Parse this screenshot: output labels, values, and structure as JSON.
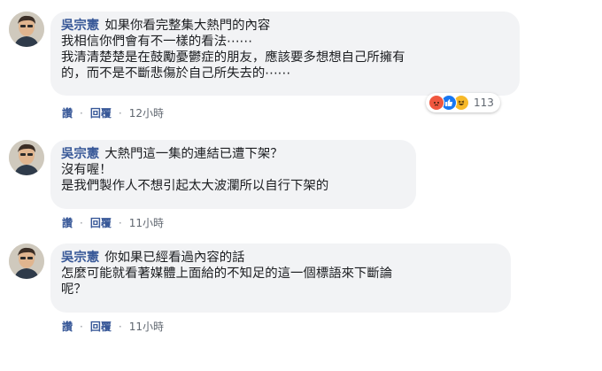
{
  "comments": [
    {
      "author": "吳宗憲",
      "lines": [
        "如果你看完整集大熱門的內容",
        "我相信你們會有不一樣的看法⋯⋯",
        "我清清楚楚是在鼓勵憂鬱症的朋友，應該要多想想自己所擁有",
        "的，而不是不斷悲傷於自己所失去的⋯⋯"
      ],
      "like_label": "讚",
      "reply_label": "回覆",
      "timestamp": "12小時",
      "reaction_count": "113"
    },
    {
      "author": "吳宗憲",
      "lines": [
        "大熱門這一集的連結已遭下架？",
        "沒有喔！",
        "是我們製作人不想引起太大波瀾所以自行下架的"
      ],
      "like_label": "讚",
      "reply_label": "回覆",
      "timestamp": "11小時"
    },
    {
      "author": "吳宗憲",
      "lines": [
        "你如果已經看過內容的話",
        "怎麼可能就看著媒體上面給的不知足的這一個標語來下斷論",
        "呢？"
      ],
      "like_label": "讚",
      "reply_label": "回覆",
      "timestamp": "11小時"
    }
  ],
  "reaction_icons": [
    "angry-icon",
    "like-icon",
    "haha-icon"
  ],
  "colors": {
    "author": "#385898",
    "bubble": "#f2f3f5",
    "meta": "#606770",
    "angry": "#f0573f",
    "like": "#1877f2",
    "haha": "#f7b928"
  }
}
